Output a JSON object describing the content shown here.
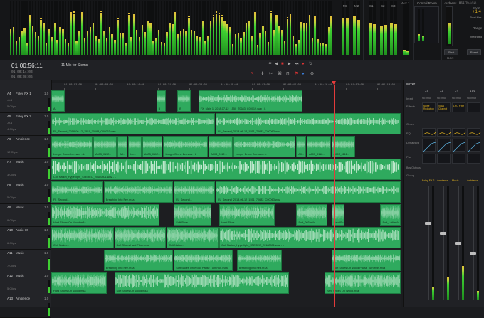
{
  "colors": {
    "clip": "#2faa5e",
    "accent": "#e8b820",
    "playhead": "#e33b3b",
    "meter": "#3fcf32"
  },
  "toolbar": {
    "timecode": "01:00:56:11",
    "timeline_name": "11 Mix for Stems",
    "tc_rows": [
      "01:00:14:03",
      "01:00:08:06"
    ]
  },
  "ruler": {
    "ticks": [
      "01:00:12:00",
      "01:00:00:00",
      "01:00:14:00",
      "01:00:21:00",
      "01:00:28:00",
      "01:00:35:00",
      "01:00:42:00",
      "01:00:49:00",
      "01:00:56:00",
      "01:01:03:00",
      "01:01:10:00"
    ]
  },
  "bridge": {
    "master_labels": [
      "M1",
      "M2",
      "S1",
      "S2",
      "S3"
    ],
    "aux_label": "Aux 1",
    "control_room": "Control Room",
    "loudness": "Loudness",
    "loudness_readout": "BS.1770-4 (LU)",
    "short_label": "Short",
    "short_value": "+1.4",
    "short_max_label": "Short Max",
    "range_label": "Range",
    "integrated_label": "Integrated",
    "start_btn": "Start",
    "reset_btn": "Reset",
    "mon_label": "MON"
  },
  "tracks": [
    {
      "id": "A4",
      "name": "Foley FX 1",
      "vol": "1.0",
      "clips_count": "5 Clips",
      "ctl": "-0.4",
      "clips": [
        {
          "name": "A_",
          "s": 0.0,
          "w": 0.04
        },
        {
          "name": "B_",
          "s": 0.3,
          "w": 0.03
        },
        {
          "name": "B_",
          "s": 0.36,
          "w": 0.04
        },
        {
          "name": "FX_Main 1_2018-07-12_1550_70683_C00019.wav - L",
          "s": 0.42,
          "w": 0.3
        }
      ]
    },
    {
      "id": "A5",
      "name": "Foley FX 2",
      "vol": "1.0",
      "clips_count": "4 Clips",
      "ctl": "-0.4",
      "clips": [
        {
          "name": "FL_Second_2018-06-12_1551_70683_C00063.wav",
          "s": 0.0,
          "w": 0.47
        },
        {
          "name": "FL_Second_2018-06-12_1551_70683_C00063.wav",
          "s": 0.47,
          "w": 0.53
        }
      ]
    },
    {
      "id": "A6",
      "name": "Ambience",
      "vol": "1.0",
      "clips_count": "12 Clips",
      "ctl": "",
      "clips": [
        {
          "name": "Longer Drone Lo...wav - L",
          "s": 0.0,
          "w": 0.12
        },
        {
          "name": "A003_0112...",
          "s": 0.12,
          "w": 0.07
        },
        {
          "name": "A0...",
          "s": 0.19,
          "w": 0.03
        },
        {
          "name": "Lo...",
          "s": 0.22,
          "w": 0.04
        },
        {
          "name": "A003_0112...",
          "s": 0.26,
          "w": 0.06
        },
        {
          "name": "Longer Drone 2ch.wav - L",
          "s": 0.32,
          "w": 0.13
        },
        {
          "name": "A003_0112...",
          "s": 0.45,
          "w": 0.07
        },
        {
          "name": "Longer Drone 2ch.wav - L",
          "s": 0.52,
          "w": 0.18
        },
        {
          "name": "A0...",
          "s": 0.7,
          "w": 0.03
        },
        {
          "name": "A003_0112...",
          "s": 0.73,
          "w": 0.07
        },
        {
          "name": "A003_0112...",
          "s": 0.8,
          "w": 0.07
        }
      ]
    },
    {
      "id": "A7",
      "name": "Music",
      "vol": "1.0",
      "clips_count": "3 Clips",
      "ctl": "",
      "clips": [
        {
          "name": "Colt Nation_Hyperlight_STEREO_20180801.wav - L",
          "s": 0.0,
          "w": 1.0
        }
      ]
    },
    {
      "id": "A8",
      "name": "Music",
      "vol": "1.0",
      "clips_count": "5 Clips",
      "ctl": "",
      "clips": [
        {
          "name": "FL_Second...",
          "s": 0.0,
          "w": 0.15
        },
        {
          "name": "Breathing Into Fee.m4a",
          "s": 0.15,
          "w": 0.2
        },
        {
          "name": "FL_Second...",
          "s": 0.35,
          "w": 0.12
        },
        {
          "name": "FL_Second_2018-06-12_1551_70683_C00063.wav",
          "s": 0.47,
          "w": 0.53
        }
      ]
    },
    {
      "id": "A9",
      "name": "Music",
      "vol": "1.0",
      "clips_count": "9 Clips",
      "ctl": "",
      "clips": [
        {
          "name": "Hard Shoes On Wood.m4a",
          "s": 0.0,
          "w": 0.31
        },
        {
          "name": "Soft Shoe...",
          "s": 0.35,
          "w": 0.11
        },
        {
          "name": "Hard Shoe...",
          "s": 0.48,
          "w": 0.16
        },
        {
          "name": "Soft_003.m4a",
          "s": 0.7,
          "w": 0.09
        },
        {
          "name": "Hard Sh...",
          "s": 0.8,
          "w": 0.04
        },
        {
          "name": "Soft_Left.m4a",
          "s": 0.94,
          "w": 0.06
        }
      ]
    },
    {
      "id": "A10",
      "name": "Audio 10",
      "vol": "1.0",
      "clips_count": "6 Clips",
      "ctl": "",
      "clips": [
        {
          "name": "Colt Nation...",
          "s": 0.0,
          "w": 0.18
        },
        {
          "name": "Soft Shoes Hard Floor.m4a",
          "s": 0.18,
          "w": 0.15
        },
        {
          "name": "Colt Nation...",
          "s": 0.33,
          "w": 0.15
        },
        {
          "name": "Colt Nation_Hyperlight_STEREO_20180801.wav - L",
          "s": 0.48,
          "w": 0.52
        }
      ]
    },
    {
      "id": "A11",
      "name": "Music",
      "vol": "1.0",
      "clips_count": "7 Clips",
      "ctl": "",
      "clips": [
        {
          "name": "Breathing Into Fee.m4a",
          "s": 0.15,
          "w": 0.2
        },
        {
          "name": "Soft Shoes On Wood Pause Turn Run.m4a",
          "s": 0.35,
          "w": 0.17
        },
        {
          "name": "Breathing Into Fee.m4a",
          "s": 0.53,
          "w": 0.13
        },
        {
          "name": "Soft Shoes On Wood Pause Turn Run.m4a",
          "s": 0.8,
          "w": 0.2
        }
      ]
    },
    {
      "id": "A12",
      "name": "Music",
      "vol": "1.0",
      "clips_count": "5 Clips",
      "ctl": "",
      "clips": [
        {
          "name": "Hard Shoes On Wood.m4a",
          "s": 0.0,
          "w": 0.16
        },
        {
          "name": "Soft Shoes On Wood.m4a",
          "s": 0.18,
          "w": 0.5
        },
        {
          "name": "Hard Shoes On Wood.m4a",
          "s": 0.78,
          "w": 0.22
        }
      ]
    },
    {
      "id": "A13",
      "name": "Ambience",
      "vol": "1.0",
      "clips_count": "",
      "ctl": "",
      "clips": []
    }
  ],
  "mixer": {
    "title": "Mixer",
    "channels": [
      "A5",
      "A6",
      "A7",
      "A13"
    ],
    "input_label": "Input",
    "input_values": [
      "No Input",
      "No Input",
      "No Input",
      "No Input"
    ],
    "effects_label": "Effects",
    "effects_values": [
      "Noise Reduction",
      "Vocal Channel",
      "LRO Filter",
      ""
    ],
    "order_label": "Order",
    "eq_label": "EQ",
    "dynamics_label": "Dynamics",
    "pan_label": "Pan",
    "bus_label": "Bus Outputs",
    "group_label": "Group",
    "strip_names": [
      "Foley FX 2",
      "Ambience",
      "Music",
      "Ambience"
    ]
  }
}
